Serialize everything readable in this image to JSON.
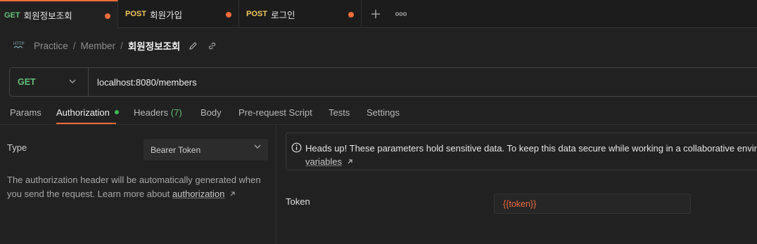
{
  "tabs": [
    {
      "method": "GET",
      "name": "회원정보조회",
      "method_color": "#63c176",
      "active": true
    },
    {
      "method": "POST",
      "name": "회원가입",
      "method_color": "#f5c85d",
      "active": false
    },
    {
      "method": "POST",
      "name": "로그인",
      "method_color": "#f5c85d",
      "active": false
    }
  ],
  "unsaved_dot_color": "#f26b3a",
  "breadcrumb": {
    "items": [
      "Practice",
      "Member"
    ],
    "current": "회원정보조회",
    "separator": "/"
  },
  "request": {
    "method": "GET",
    "url": "localhost:8080/members"
  },
  "request_tabs": {
    "params": "Params",
    "authorization": "Authorization",
    "headers": "Headers",
    "headers_count": "(7)",
    "body": "Body",
    "prerequest": "Pre-request Script",
    "tests": "Tests",
    "settings": "Settings"
  },
  "auth": {
    "type_label": "Type",
    "type_value": "Bearer Token",
    "description": "The authorization header will be automatically generated when you send the request. Learn more about ",
    "description_link": "authorization",
    "notice_text": "Heads up! These parameters hold sensitive data. To keep this data secure while working in a collaborative environ",
    "notice_link": "variables",
    "token_label": "Token",
    "token_value": "{{token}}"
  }
}
